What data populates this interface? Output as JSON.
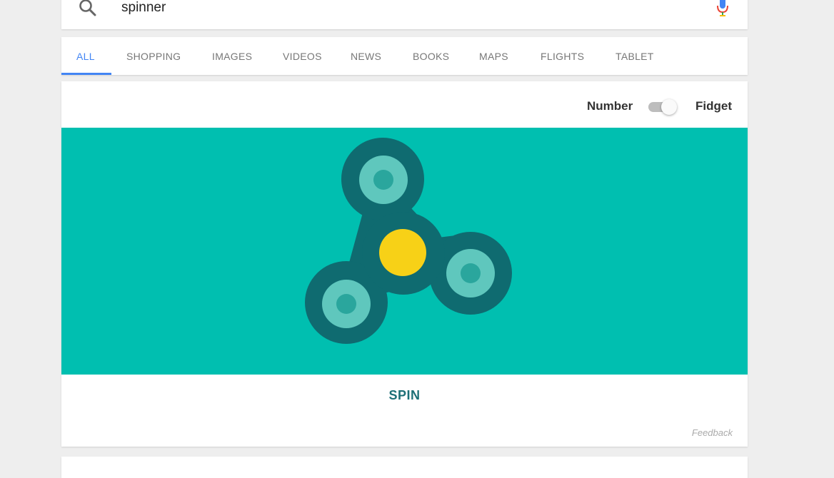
{
  "search": {
    "query": "spinner"
  },
  "tabs": [
    {
      "label": "ALL",
      "active": true
    },
    {
      "label": "SHOPPING"
    },
    {
      "label": "IMAGES"
    },
    {
      "label": "VIDEOS"
    },
    {
      "label": "NEWS"
    },
    {
      "label": "BOOKS"
    },
    {
      "label": "MAPS"
    },
    {
      "label": "FLIGHTS"
    },
    {
      "label": "TABLET"
    }
  ],
  "toggle": {
    "left_label": "Number",
    "right_label": "Fidget",
    "mode": "Fidget"
  },
  "spinner": {
    "background_color": "#00bfb0",
    "body_color": "#0f6b70",
    "bearing_ring_color": "#5fc7bd",
    "bearing_center_color": "#2aa69d",
    "hub_color": "#f7d117"
  },
  "spin_button": {
    "label": "SPIN"
  },
  "feedback": {
    "label": "Feedback"
  },
  "colors": {
    "accent": "#4285f4"
  }
}
